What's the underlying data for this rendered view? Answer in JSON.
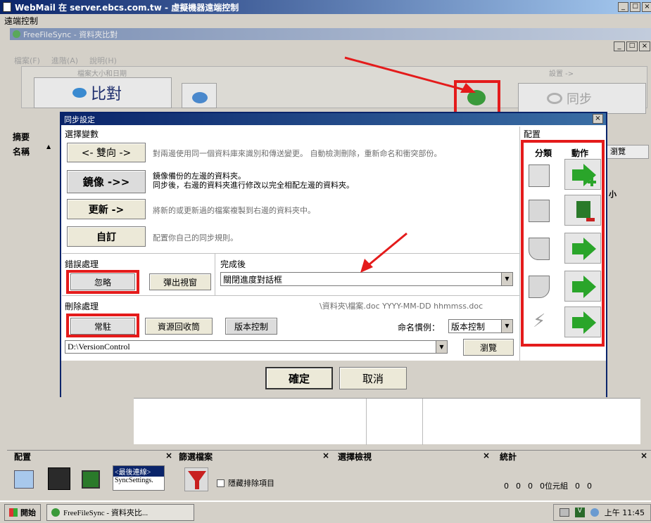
{
  "window": {
    "title": "WebMail 在 server.ebcs.com.tw - 虛擬機器遠端控制",
    "menu": "遠端控制"
  },
  "inner": {
    "title": "FreeFileSync - 資料夾比對",
    "menu": [
      "檔案(F)",
      "進階(A)",
      "說明(H)"
    ]
  },
  "toolbar": {
    "compare_label": "比對",
    "sync_label": "同步",
    "hint_left": "檔案大小和日期",
    "hint_right": "設置 ->"
  },
  "bg": {
    "summary_label": "摘要",
    "name_col": "名稱",
    "browse": "瀏覽",
    "size_col": "小"
  },
  "dialog": {
    "title": "同步設定",
    "variant_title": "選擇變數",
    "variants": [
      {
        "label": "<- 雙向 ->",
        "desc": "對兩邊使用同一個資料庫來識別和傳送變更。 自動檢測刪除，重新命名和衝突部份。"
      },
      {
        "label": "鏡像 ->>",
        "desc": "鏡像備份的左邊的資料夾。\n同步後，右邊的資料夾進行修改以完全相配左邊的資料夾。"
      },
      {
        "label": "更新 ->",
        "desc": "將新的或更新過的檔案複製到右邊的資料夾中。"
      },
      {
        "label": "自訂",
        "desc": "配置你自己的同步規則。"
      }
    ],
    "config_title": "配置",
    "config_col_category": "分類",
    "config_col_action": "動作",
    "error_title": "錯誤處理",
    "error_ignore": "忽略",
    "error_popup": "彈出視窗",
    "after_title": "完成後",
    "after_value": "關閉進度對話框",
    "delete_title": "刪除處理",
    "delete_permanent": "常駐",
    "delete_recycle": "資源回收筒",
    "delete_versioning": "版本控制",
    "filename_pattern": "\\資料夾\\檔案.doc YYYY-MM-DD hhmmss.doc",
    "naming_label": "命名慣例：",
    "naming_value": "版本控制",
    "path_value": "D:\\VersionControl",
    "browse_label": "瀏覽",
    "ok_label": "確定",
    "cancel_label": "取消"
  },
  "bottom": {
    "config_title": "配置",
    "filter_title": "篩選檔案",
    "compare_title": "選擇檢視",
    "stats_title": "統計",
    "last_sessions": "<最後連線>",
    "sync_settings": "SyncSettings.",
    "hide_excluded": "隱藏排除項目",
    "stats_values": [
      "0",
      "0",
      "0",
      "0位元組",
      "0",
      "0"
    ]
  },
  "taskbar": {
    "start": "開始",
    "task": "FreeFileSync - 資料夾比...",
    "clock": "上午 11:45"
  },
  "colors": {
    "title_blue": "#0a246a",
    "red": "#e41b1b",
    "green_arrow": "#2aa52a"
  }
}
